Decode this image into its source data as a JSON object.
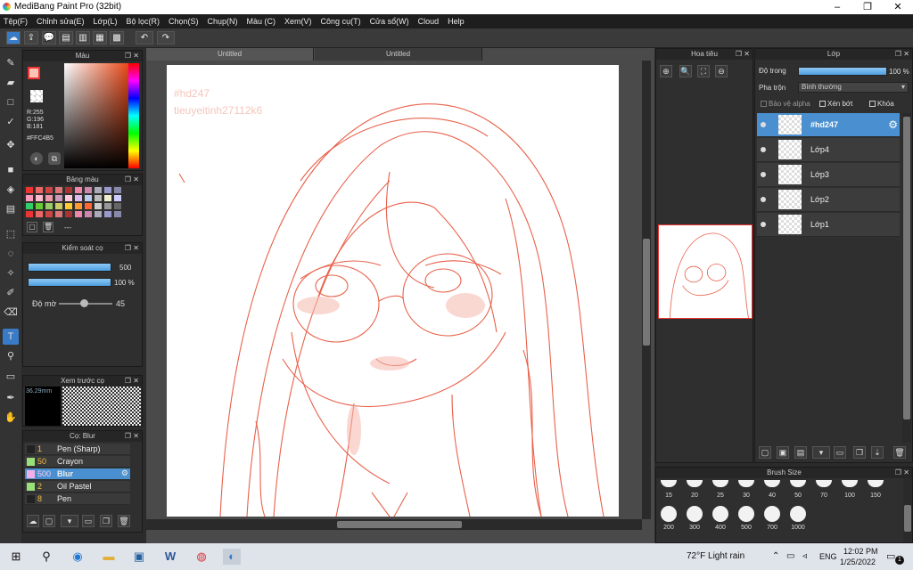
{
  "app": {
    "title": "MediBang Paint Pro (32bit)"
  },
  "menu": [
    "Tệp(F)",
    "Chỉnh sửa(E)",
    "Lớp(L)",
    "Bộ lọc(R)",
    "Chọn(S)",
    "Chụp(N)",
    "Màu (C)",
    "Xem(V)",
    "Công cụ(T)",
    "Cửa sổ(W)",
    "Cloud",
    "Help"
  ],
  "color_panel": {
    "title": "Màu",
    "r": "R:255",
    "g": "G:196",
    "b": "B:181",
    "hex": "#FFC4B5",
    "primary": "#ffc4b5"
  },
  "palette_panel": {
    "title": "Bảng màu",
    "name": "---"
  },
  "brush_control": {
    "title": "Kiểm soát cọ",
    "size": "500",
    "opacity": "100 %",
    "blur_label": "Độ mờ",
    "blur_value": "45"
  },
  "brush_preview": {
    "title": "Xem trước cọ",
    "size_label": "36.29mm"
  },
  "brush_list": {
    "title": "Cọ: Blur",
    "items": [
      {
        "num": "1",
        "name": "Pen (Sharp)",
        "color": "#222222"
      },
      {
        "num": "50",
        "name": "Crayon",
        "color": "#9ae07a"
      },
      {
        "num": "500",
        "name": "Blur",
        "color": "#f3b0e8"
      },
      {
        "num": "2",
        "name": "Oil Pastel",
        "color": "#9ae07a"
      },
      {
        "num": "8",
        "name": "Pen",
        "color": "#222222"
      }
    ]
  },
  "canvas": {
    "tabs": [
      "Untitled",
      "Untitled"
    ],
    "watermark_1": "#hd247",
    "watermark_2": "tieuyeitinh27112k6"
  },
  "navigator": {
    "title": "Hoa tiêu"
  },
  "layers": {
    "title": "Lớp",
    "opacity_label": "Độ trong",
    "opacity_value": "100 %",
    "blend_label": "Pha trộn",
    "blend_value": "Bình thường",
    "protect_alpha": "Bảo vệ alpha",
    "clipping": "Xén bớt",
    "lock": "Khóa",
    "items": [
      {
        "name": "#hd247",
        "selected": true
      },
      {
        "name": "Lớp4",
        "selected": false
      },
      {
        "name": "Lớp3",
        "selected": false
      },
      {
        "name": "Lớp2",
        "selected": false
      },
      {
        "name": "Lớp1",
        "selected": false
      }
    ]
  },
  "brush_size": {
    "title": "Brush Size",
    "row1": [
      "15",
      "20",
      "25",
      "30",
      "40",
      "50",
      "70",
      "100",
      "150"
    ],
    "row2": [
      "200",
      "300",
      "400",
      "500",
      "700",
      "1000"
    ]
  },
  "taskbar": {
    "weather": "72°F  Light rain",
    "lang": "ENG",
    "time": "12:02 PM",
    "date": "1/25/2022",
    "notif": "1"
  }
}
